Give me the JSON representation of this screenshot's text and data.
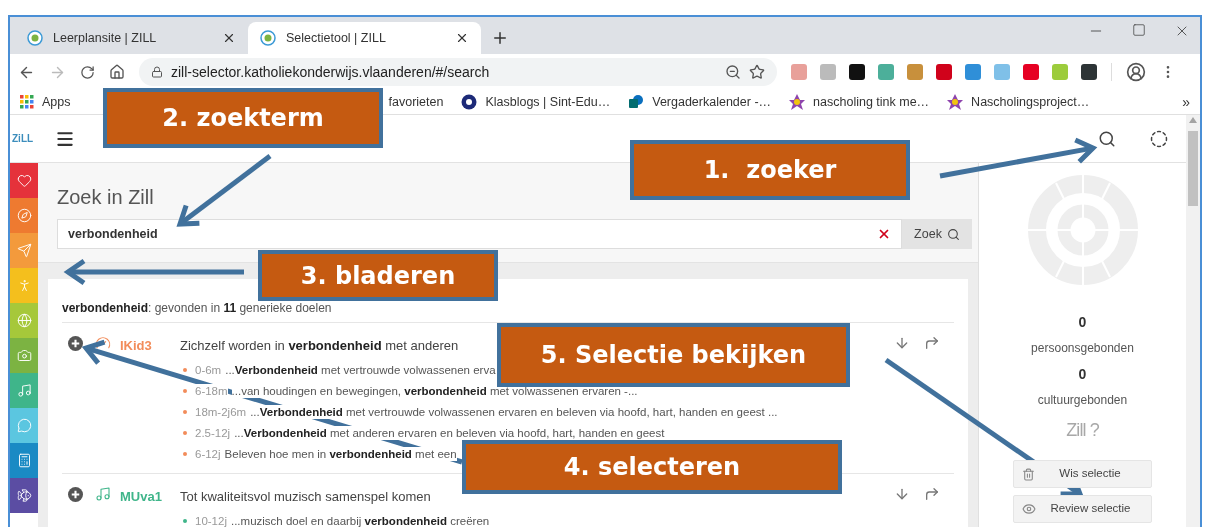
{
  "browser": {
    "tabs": [
      {
        "title": "Leerplansite | ZILL",
        "selected": false
      },
      {
        "title": "Selectietool | ZILL",
        "selected": true
      }
    ],
    "url": "zill-selector.katholiekonderwijs.vlaanderen/#/search",
    "bookmarks": [
      {
        "label": "Apps",
        "kind": "apps"
      },
      {
        "label": "favorieten",
        "kind": "none"
      },
      {
        "label": "Klasblogs | Sint-Edu…",
        "kind": "globe"
      },
      {
        "label": "Vergaderkalender -…",
        "kind": "sharepoint"
      },
      {
        "label": "nascholing tink me…",
        "kind": "flower"
      },
      {
        "label": "Nascholingsproject…",
        "kind": "flower"
      }
    ],
    "bookmarks_more": "»"
  },
  "app": {
    "logo": "ZiLL",
    "sidebar": [
      {
        "kind": "heart",
        "color": "#e5323b"
      },
      {
        "kind": "compass",
        "color": "#ee7a30"
      },
      {
        "kind": "send",
        "color": "#f39a3c"
      },
      {
        "kind": "figure",
        "color": "#f4bf1d"
      },
      {
        "kind": "globe",
        "color": "#a6c83a"
      },
      {
        "kind": "camera",
        "color": "#7cb342"
      },
      {
        "kind": "music",
        "color": "#3fb58a"
      },
      {
        "kind": "chat",
        "color": "#5bc6e0"
      },
      {
        "kind": "calculator",
        "color": "#1a8ac4"
      },
      {
        "kind": "fish",
        "color": "#5b4da3"
      }
    ],
    "heading": "Zoek in Zill",
    "search": {
      "value": "verbondenheid",
      "button": "Zoek"
    },
    "results": {
      "summary": "**verbondenheid**: gevonden in **11** generieke doelen",
      "items": [
        {
          "kind": "gauge",
          "code": "IKid3",
          "color": "#f28c5a",
          "title": "Zichzelf worden in **verbondenheid** met anderen",
          "bullets": [
            {
              "age": "0-6m",
              "text": "...**Verbondenheid** met vertrouwde volwassenen erva"
            },
            {
              "age": "6-18m",
              "text": "...van houdingen en bewegingen, **verbondenheid** met volwassenen ervaren -..."
            },
            {
              "age": "18m-2j6m",
              "text": "...**Verbondenheid** met vertrouwde volwassenen ervaren en beleven via hoofd, hart, handen en geest ..."
            },
            {
              "age": "2.5-12j",
              "text": "...**Verbondenheid** met anderen ervaren en beleven via hoofd, hart, handen en geest"
            },
            {
              "age": "6-12j",
              "text": "Beleven hoe men in **verbondenheid** met een"
            }
          ]
        },
        {
          "kind": "music",
          "code": "MUva1",
          "color": "#3fb58a",
          "title": "Tot kwaliteitsvol muzisch samenspel komen",
          "bullets": [
            {
              "age": "10-12j",
              "text": "...muzisch doel en daarbij **verbondenheid** creëren"
            }
          ]
        }
      ]
    },
    "selection": {
      "stats": [
        {
          "value": "0",
          "label": "persoonsgebonden"
        },
        {
          "value": "0",
          "label": "cultuurgebonden"
        }
      ],
      "logo": "Zill ?",
      "buttons": [
        {
          "label": "Wis selectie",
          "kind": "trash"
        },
        {
          "label": "Review selectie",
          "kind": "eye"
        }
      ]
    }
  },
  "callouts": [
    {
      "label": "1.  zoeker"
    },
    {
      "label": "2. zoekterm"
    },
    {
      "label": "3. bladeren"
    },
    {
      "label": "4. selecteren"
    },
    {
      "label": "5. Selectie bekijken"
    }
  ]
}
